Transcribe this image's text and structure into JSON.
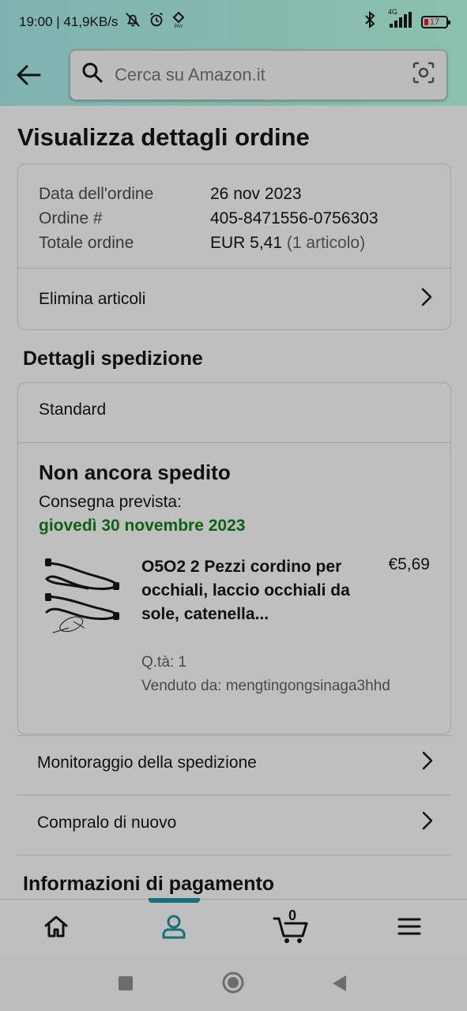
{
  "status_bar": {
    "time_speed": "19:00 | 41,9KB/s",
    "network_label": "4G",
    "battery_level": "17"
  },
  "header": {
    "search_placeholder": "Cerca su Amazon.it"
  },
  "page": {
    "title": "Visualizza dettagli ordine"
  },
  "order_info": {
    "rows": [
      {
        "label": "Data dell'ordine",
        "value": "26 nov 2023",
        "extra": ""
      },
      {
        "label": "Ordine #",
        "value": "405-8471556-0756303",
        "extra": ""
      },
      {
        "label": "Totale ordine",
        "value": "EUR 5,41",
        "extra": " (1 articolo)"
      }
    ],
    "delete_items_label": "Elimina articoli"
  },
  "shipping": {
    "section_title": "Dettagli spedizione",
    "method": "Standard",
    "status": "Non ancora spedito",
    "delivery_label": "Consegna prevista:",
    "delivery_date": "giovedì 30 novembre 2023",
    "product": {
      "title": "O5O2 2 Pezzi cordino per occhiali, laccio occhiali da sole, catenella...",
      "price": "€5,69",
      "quantity": "Q.tà: 1",
      "seller": "Venduto da: mengtingongsinaga3hhd"
    }
  },
  "actions": {
    "track_label": "Monitoraggio della spedizione",
    "buy_again_label": "Compralo di nuovo"
  },
  "payment": {
    "section_title": "Informazioni di pagamento"
  },
  "bottom_nav": {
    "cart_count": "0"
  },
  "colors": {
    "accent_teal": "#16717a",
    "delivery_green": "#0b6312",
    "battery_red": "#d0021b"
  }
}
